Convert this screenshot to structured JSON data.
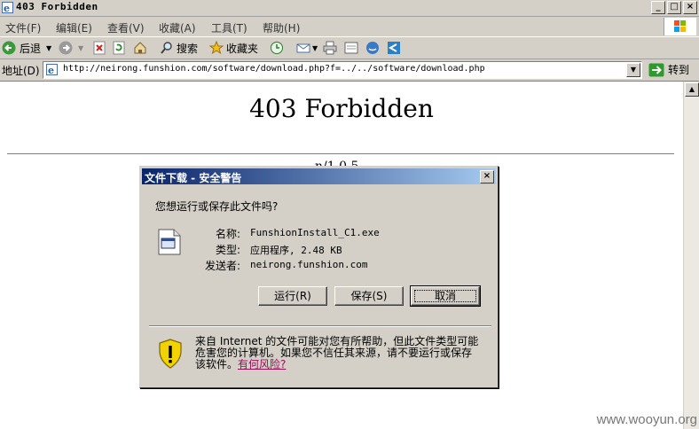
{
  "window": {
    "title": "403 Forbidden"
  },
  "menu": {
    "items": [
      "文件(F)",
      "编辑(E)",
      "查看(V)",
      "收藏(A)",
      "工具(T)",
      "帮助(H)"
    ]
  },
  "toolbar": {
    "back_label": "后退",
    "search_label": "搜索",
    "favorites_label": "收藏夹"
  },
  "address": {
    "label": "地址(D)",
    "url": "http://neirong.funshion.com/software/download.php?f=../../software/download.php",
    "go_label": "转到"
  },
  "page": {
    "heading": "403 Forbidden",
    "partial_text": "n/1.0.5"
  },
  "dialog": {
    "title": "文件下载 - 安全警告",
    "question": "您想运行或保存此文件吗?",
    "name_label": "名称:",
    "name_value": "FunshionInstall_C1.exe",
    "type_label": "类型:",
    "type_value": "应用程序, 2.48 KB",
    "from_label": "发送者:",
    "from_value": "neirong.funshion.com",
    "run_button": "运行(R)",
    "save_button": "保存(S)",
    "cancel_button": "取消",
    "warning_text": "来自 Internet 的文件可能对您有所帮助，但此文件类型可能危害您的计算机。如果您不信任其来源，请不要运行或保存该软件。",
    "risk_link": "有何风险?"
  },
  "watermark": "www.wooyun.org"
}
